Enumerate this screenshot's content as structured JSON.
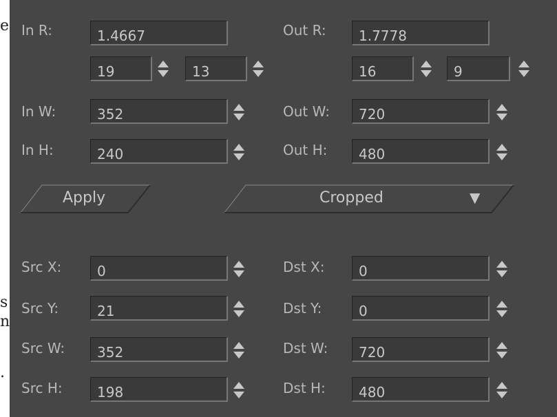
{
  "background_fragments": {
    "top": "e",
    "middle_1": "s",
    "middle_2": "n",
    "bottom": "."
  },
  "labels": {
    "in_r": "In R:",
    "out_r": "Out R:",
    "in_w": "In W:",
    "out_w": "Out W:",
    "in_h": "In H:",
    "out_h": "Out H:",
    "src_x": "Src X:",
    "dst_x": "Dst X:",
    "src_y": "Src Y:",
    "dst_y": "Dst Y:",
    "src_w": "Src W:",
    "dst_w": "Dst W:",
    "src_h": "Src H:",
    "dst_h": "Dst H:"
  },
  "values": {
    "in_r": "1.4667",
    "out_r": "1.7778",
    "in_r_num": "19",
    "in_r_den": "13",
    "out_r_num": "16",
    "out_r_den": "9",
    "in_w": "352",
    "out_w": "720",
    "in_h": "240",
    "out_h": "480",
    "src_x": "0",
    "dst_x": "0",
    "src_y": "21",
    "dst_y": "0",
    "src_w": "352",
    "dst_w": "720",
    "src_h": "198",
    "dst_h": "480"
  },
  "buttons": {
    "apply": "Apply",
    "mode": "Cropped",
    "mode_arrow": "▼"
  },
  "icons": {
    "spinner": "up-down-spinner-icon",
    "dropdown": "chevron-down-icon"
  },
  "colors": {
    "panel": "#464646",
    "field": "#3a3a3a",
    "text": "#c8c8c8",
    "label": "#b8b8b8"
  }
}
